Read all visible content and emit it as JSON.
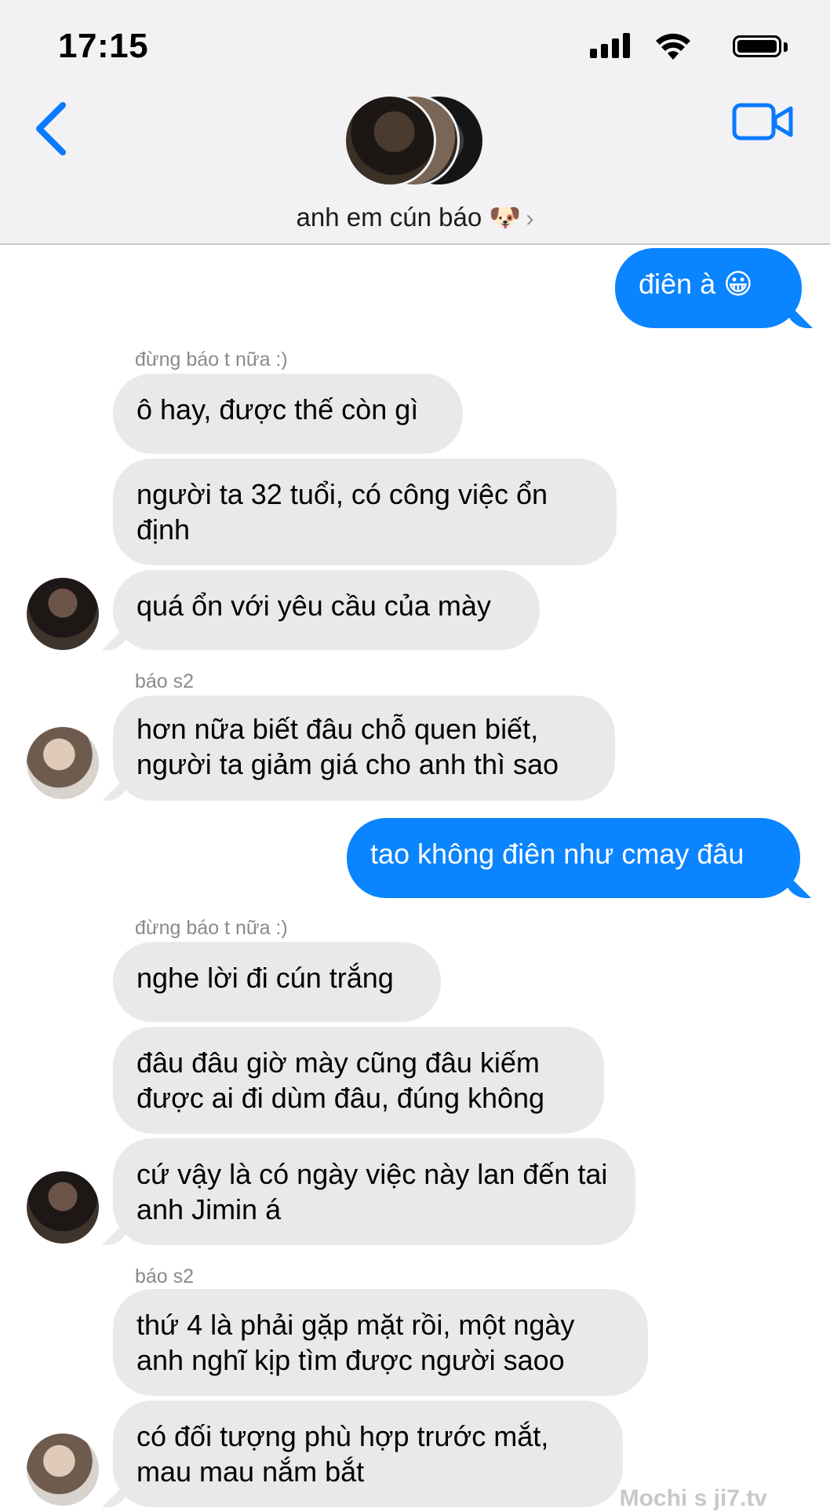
{
  "status": {
    "time": "17:15"
  },
  "header": {
    "title": "anh em cún báo 🐶",
    "chevron": "›"
  },
  "senders": {
    "a": "đừng báo t nữa :)",
    "b": "báo s2"
  },
  "messages": [
    {
      "text": "điên à 😀"
    },
    {
      "text": "ô hay, được thế còn gì"
    },
    {
      "text": "người ta 32 tuổi, có công việc ổn định"
    },
    {
      "text": "quá ổn với yêu cầu của mày"
    },
    {
      "text": "hơn nữa biết đâu chỗ quen biết, người ta giảm giá cho anh thì sao"
    },
    {
      "text": "tao không điên như cmay đâu"
    },
    {
      "text": "nghe lời đi cún trắng"
    },
    {
      "text": "đâu đâu giờ mày cũng đâu kiếm được ai đi dùm đâu, đúng không"
    },
    {
      "text": "cứ vậy là có ngày việc này lan đến tai anh Jimin á"
    },
    {
      "text": "thứ 4 là phải gặp mặt rồi, một ngày anh nghĩ kịp tìm được người saoo"
    },
    {
      "text": "có đối tượng phù hợp  trước mắt, mau mau nắm bắt"
    }
  ],
  "watermark": "Mochi s ji7.tv"
}
